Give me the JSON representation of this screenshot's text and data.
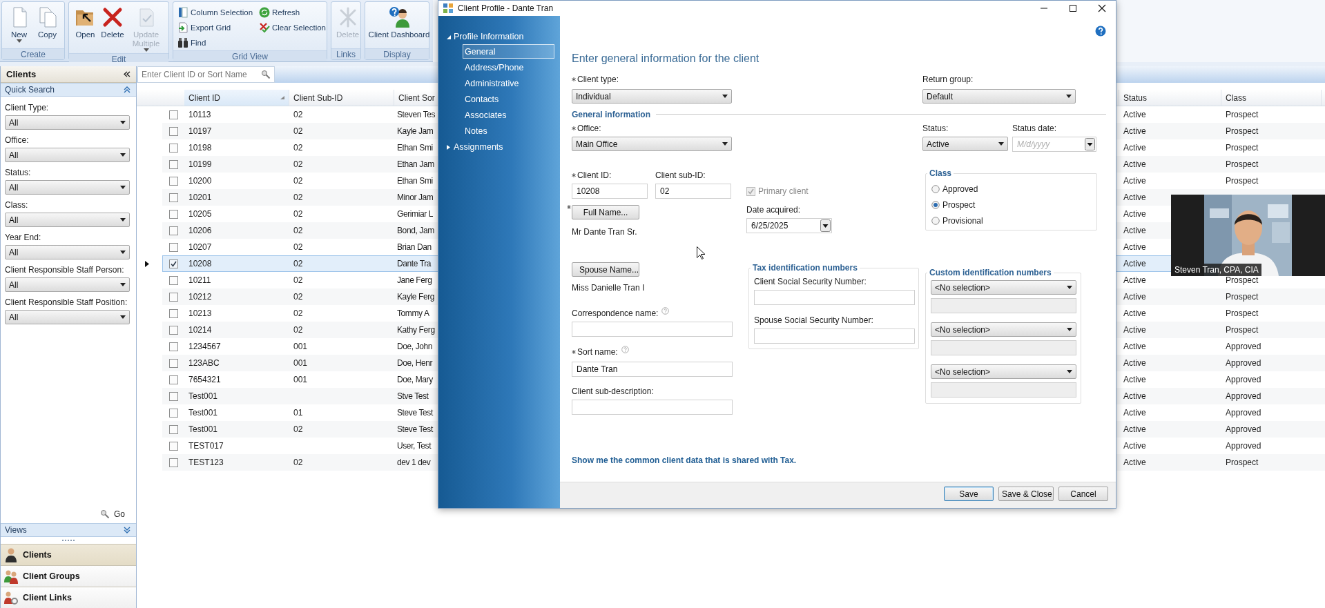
{
  "ribbon": {
    "groups": [
      {
        "label": "Create",
        "buttons": [
          {
            "kind": "large",
            "label": "New",
            "disabled": false,
            "dropdown": true
          },
          {
            "kind": "large",
            "label": "Copy",
            "disabled": false,
            "dropdown": false
          }
        ]
      },
      {
        "label": "Edit",
        "buttons": [
          {
            "kind": "large",
            "label": "Open",
            "disabled": false,
            "dropdown": false
          },
          {
            "kind": "large",
            "label": "Delete",
            "disabled": false,
            "dropdown": false
          },
          {
            "kind": "large",
            "label": "Update Multiple",
            "disabled": true,
            "dropdown": true
          }
        ]
      },
      {
        "label": "Grid View",
        "buttons": [
          {
            "kind": "small",
            "label": "Column Selection",
            "disabled": false,
            "dropdown": false
          },
          {
            "kind": "small",
            "label": "Export Grid",
            "disabled": false,
            "dropdown": false
          },
          {
            "kind": "small",
            "label": "Find",
            "disabled": false,
            "dropdown": false
          },
          {
            "kind": "small",
            "label": "Refresh",
            "disabled": false,
            "dropdown": false
          },
          {
            "kind": "small",
            "label": "Clear Selection",
            "disabled": false,
            "dropdown": false
          }
        ]
      },
      {
        "label": "Links",
        "buttons": [
          {
            "kind": "large",
            "label": "Delete",
            "disabled": true,
            "dropdown": false
          }
        ]
      },
      {
        "label": "Display",
        "buttons": [
          {
            "kind": "large",
            "label": "Client Dashboard",
            "disabled": false,
            "dropdown": false
          }
        ]
      }
    ]
  },
  "sidebar": {
    "title": "Clients",
    "quick_search": {
      "title": "Quick Search",
      "expanded": true,
      "filters": [
        {
          "label": "Client Type:",
          "value": "All"
        },
        {
          "label": "Office:",
          "value": "All"
        },
        {
          "label": "Status:",
          "value": "All"
        },
        {
          "label": "Class:",
          "value": "All"
        },
        {
          "label": "Year End:",
          "value": "All"
        },
        {
          "label": "Client Responsible Staff Person:",
          "value": "All"
        },
        {
          "label": "Client Responsible Staff Position:",
          "value": "All"
        }
      ]
    },
    "go": "Go",
    "views": {
      "title": "Views",
      "expanded": false
    },
    "nav": [
      {
        "label": "Clients",
        "selected": true
      },
      {
        "label": "Client Groups",
        "selected": false
      },
      {
        "label": "Client Links",
        "selected": false
      }
    ]
  },
  "search": {
    "placeholder": "Enter Client ID or Sort Name"
  },
  "grid": {
    "columns": [
      {
        "label": "Client ID",
        "sorted": true
      },
      {
        "label": "Client Sub-ID",
        "sorted": false
      },
      {
        "label": "Client Sor",
        "sorted": false
      },
      {
        "label": "Status",
        "sorted": false
      },
      {
        "label": "Class",
        "sorted": false
      }
    ],
    "rows": [
      {
        "id": "10113",
        "sub_id": "02",
        "sort_name": "Steven Tes",
        "status": "Active",
        "class": "Prospect",
        "checked": false,
        "selected": false
      },
      {
        "id": "10197",
        "sub_id": "02",
        "sort_name": "Kayle Jam",
        "status": "Active",
        "class": "Prospect",
        "checked": false,
        "selected": false
      },
      {
        "id": "10198",
        "sub_id": "02",
        "sort_name": "Ethan Smi",
        "status": "Active",
        "class": "Prospect",
        "checked": false,
        "selected": false
      },
      {
        "id": "10199",
        "sub_id": "02",
        "sort_name": "Ethan Jam",
        "status": "Active",
        "class": "Prospect",
        "checked": false,
        "selected": false
      },
      {
        "id": "10200",
        "sub_id": "02",
        "sort_name": "Ethan Smi",
        "status": "Active",
        "class": "Prospect",
        "checked": false,
        "selected": false
      },
      {
        "id": "10201",
        "sub_id": "02",
        "sort_name": "Minor Jam",
        "status": "Active",
        "checked": false,
        "selected": false
      },
      {
        "id": "10205",
        "sub_id": "02",
        "sort_name": "Gerimiar L",
        "status": "Active",
        "checked": false,
        "selected": false
      },
      {
        "id": "10206",
        "sub_id": "02",
        "sort_name": "Bond, Jam",
        "status": "Active",
        "checked": false,
        "selected": false
      },
      {
        "id": "10207",
        "sub_id": "02",
        "sort_name": "Brian Dan",
        "status": "Active",
        "checked": false,
        "selected": false
      },
      {
        "id": "10208",
        "sub_id": "02",
        "sort_name": "Dante Tra",
        "status": "Active",
        "checked": true,
        "selected": true
      },
      {
        "id": "10211",
        "sub_id": "02",
        "sort_name": "Jane Ferg",
        "status": "Active",
        "class": "Prospect",
        "checked": false,
        "selected": false
      },
      {
        "id": "10212",
        "sub_id": "02",
        "sort_name": "Kayle Ferg",
        "status": "Active",
        "class": "Prospect",
        "checked": false,
        "selected": false
      },
      {
        "id": "10213",
        "sub_id": "02",
        "sort_name": "Tommy A",
        "status": "Active",
        "class": "Prospect",
        "checked": false,
        "selected": false
      },
      {
        "id": "10214",
        "sub_id": "02",
        "sort_name": "Kathy Ferg",
        "status": "Active",
        "class": "Prospect",
        "checked": false,
        "selected": false
      },
      {
        "id": "1234567",
        "sub_id": "001",
        "sort_name": "Doe, John",
        "status": "Active",
        "class": "Approved",
        "checked": false,
        "selected": false
      },
      {
        "id": "123ABC",
        "sub_id": "001",
        "sort_name": "Doe, Henr",
        "status": "Active",
        "class": "Approved",
        "checked": false,
        "selected": false
      },
      {
        "id": "7654321",
        "sub_id": "001",
        "sort_name": "Doe, Mary",
        "status": "Active",
        "class": "Approved",
        "checked": false,
        "selected": false
      },
      {
        "id": "Test001",
        "sort_name": "Stve Test",
        "status": "Active",
        "class": "Approved",
        "checked": false,
        "selected": false
      },
      {
        "id": "Test001",
        "sub_id": "01",
        "sort_name": "Steve Test",
        "status": "Active",
        "class": "Approved",
        "checked": false,
        "selected": false
      },
      {
        "id": "Test001",
        "sub_id": "02",
        "sort_name": "Steve Test",
        "status": "Active",
        "class": "Approved",
        "checked": false,
        "selected": false
      },
      {
        "id": "TEST017",
        "sort_name": "User, Test",
        "status": "Active",
        "class": "Approved",
        "checked": false,
        "selected": false
      },
      {
        "id": "TEST123",
        "sub_id": "02",
        "sort_name": "dev 1 dev",
        "status": "Active",
        "class": "Prospect",
        "checked": false,
        "selected": false
      }
    ]
  },
  "dialog": {
    "title": "Client Profile - Dante Tran",
    "nav": [
      {
        "label": "Profile Information",
        "expanded": true,
        "children": [
          {
            "label": "General",
            "selected": true
          },
          {
            "label": "Address/Phone",
            "selected": false
          },
          {
            "label": "Administrative",
            "selected": false
          },
          {
            "label": "Contacts",
            "selected": false
          },
          {
            "label": "Associates",
            "selected": false
          },
          {
            "label": "Notes",
            "selected": false
          }
        ]
      },
      {
        "label": "Assignments",
        "expanded": false
      }
    ],
    "heading": "Enter general information for the client",
    "client_type": {
      "label": "Client type:",
      "required": true,
      "value": "Individual"
    },
    "return_group": {
      "label": "Return group:",
      "value": "Default"
    },
    "section": "General information",
    "office": {
      "label": "Office:",
      "required": true,
      "value": "Main Office"
    },
    "status": {
      "label": "Status:",
      "value": "Active"
    },
    "status_date": {
      "label": "Status date:",
      "placeholder": "M/d/yyyy"
    },
    "client_id": {
      "label": "Client ID:",
      "required": true,
      "value": "10208"
    },
    "client_sub_id": {
      "label": "Client sub-ID:",
      "value": "02"
    },
    "primary_client": {
      "label": "Primary client",
      "checked": true,
      "disabled": true
    },
    "date_acquired": {
      "label": "Date acquired:",
      "value": "6/25/2025"
    },
    "class": {
      "title": "Class",
      "options": [
        {
          "label": "Approved",
          "selected": false
        },
        {
          "label": "Prospect",
          "selected": true
        },
        {
          "label": "Provisional",
          "selected": false
        }
      ]
    },
    "full_name": {
      "button": "Full Name...",
      "required": true,
      "value": "Mr Dante Tran Sr."
    },
    "spouse_name": {
      "button": "Spouse Name...",
      "value": "Miss Danielle Tran I"
    },
    "correspondence_name": {
      "label": "Correspondence name:",
      "help": true
    },
    "sort_name": {
      "label": "Sort name:",
      "required": true,
      "help": true,
      "value": "Dante Tran"
    },
    "sub_description": {
      "label": "Client sub-description:"
    },
    "tax_ids": {
      "title": "Tax identification numbers",
      "fields": [
        {
          "label": "Client Social Security Number:"
        },
        {
          "label": "Spouse Social Security Number:"
        }
      ]
    },
    "custom_ids": {
      "title": "Custom identification numbers",
      "entries": [
        {
          "value": "<No selection>"
        },
        {
          "value": "<No selection>"
        },
        {
          "value": "<No selection>"
        }
      ]
    },
    "link": "Show me the common client data that is shared with Tax.",
    "buttons": [
      {
        "label": "Save",
        "default": true
      },
      {
        "label": "Save & Close",
        "default": false
      },
      {
        "label": "Cancel",
        "default": false
      }
    ]
  },
  "video": {
    "name": "Steven Tran, CPA, CIA"
  }
}
